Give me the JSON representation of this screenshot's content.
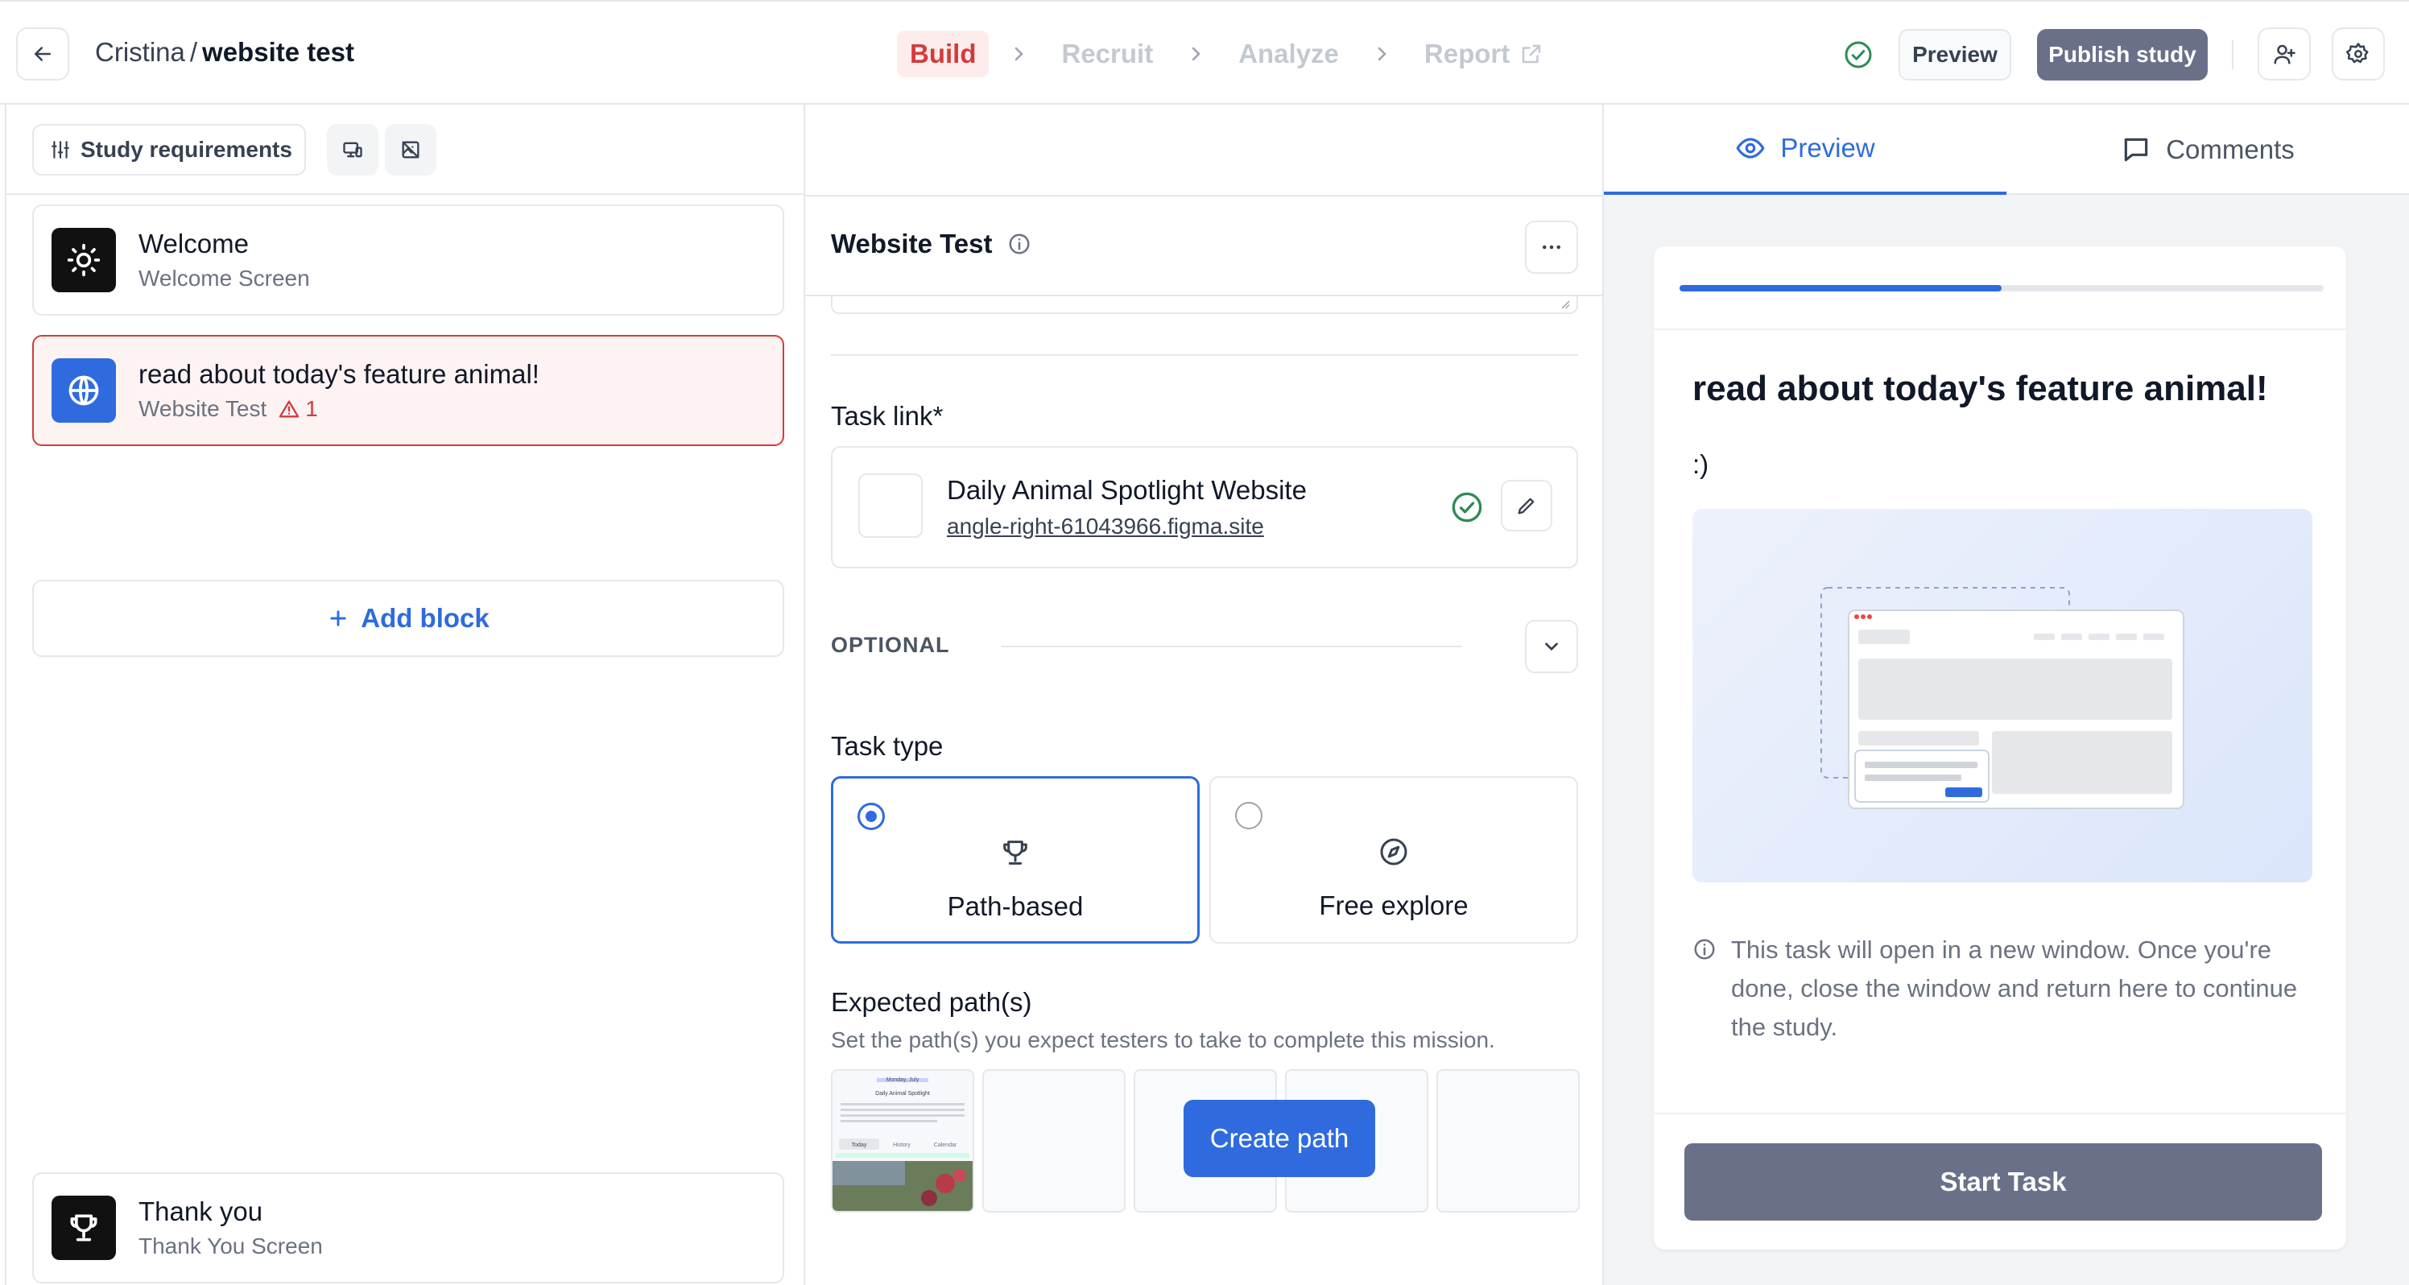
{
  "header": {
    "owner": "Cristina",
    "separator": "/",
    "study_name": "website test",
    "steps": [
      {
        "label": "Build"
      },
      {
        "label": "Recruit"
      },
      {
        "label": "Analyze"
      },
      {
        "label": "Report"
      }
    ],
    "preview_label": "Preview",
    "publish_label": "Publish study"
  },
  "left": {
    "requirements_label": "Study requirements",
    "blocks": [
      {
        "title": "Welcome",
        "subtitle": "Welcome Screen",
        "icon": "sun-icon"
      },
      {
        "title": "read about today's feature animal!",
        "subtitle": "Website Test",
        "icon": "globe-icon",
        "warning_count": "1"
      },
      {
        "title": "Thank you",
        "subtitle": "Thank You Screen",
        "icon": "trophy-icon"
      }
    ],
    "add_block_label": "Add block"
  },
  "editor": {
    "title": "Website Test",
    "task_link_label": "Task link*",
    "link_title": "Daily Animal Spotlight Website",
    "link_url": "angle-right-61043966.figma.site",
    "optional_label": "OPTIONAL",
    "task_type_label": "Task type",
    "task_types": [
      {
        "label": "Path-based",
        "selected": true,
        "icon": "trophy-icon"
      },
      {
        "label": "Free explore",
        "selected": false,
        "icon": "compass-icon"
      }
    ],
    "expected_paths_label": "Expected path(s)",
    "expected_paths_help": "Set the path(s) you expect testers to take to complete this mission.",
    "create_path_label": "Create path",
    "frame_thumb": {
      "date": "Monday, July",
      "heading": "Daily Animal Spotlight",
      "tab1": "Today",
      "tab2": "History",
      "tab3": "Calendar"
    }
  },
  "preview": {
    "tab_preview": "Preview",
    "tab_comments": "Comments",
    "progress": 0.5,
    "task_title": "read about today's feature animal!",
    "task_body": ":)",
    "note": "This task will open in a new window. Once you're done, close the window and return here to continue the study.",
    "start_label": "Start Task"
  },
  "colors": {
    "accent": "#2f6bde",
    "danger": "#d33b3b",
    "publish_bg": "#6b7089",
    "success": "#2e8b57"
  }
}
